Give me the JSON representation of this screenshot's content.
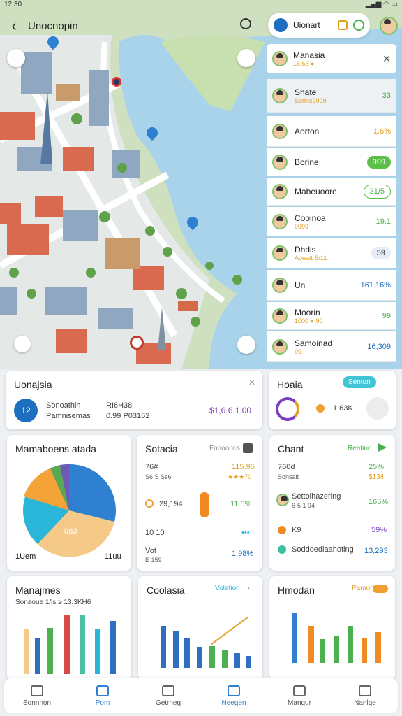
{
  "status": {
    "time": "12:30"
  },
  "header": {
    "title": "Unocnopin"
  },
  "account_pill": {
    "label": "Uionart"
  },
  "notification": {
    "name": "Manasia",
    "sub": "16:63 ●"
  },
  "list": [
    {
      "name": "Snate",
      "sub": "Sonns9999",
      "value": "33",
      "kind": "text",
      "color": "#4caf50"
    },
    {
      "name": "Aorton",
      "value": "1.6%",
      "kind": "text",
      "color": "#e0a020"
    },
    {
      "name": "Borine",
      "value": "999",
      "kind": "pill-green"
    },
    {
      "name": "Mabeuoore",
      "value": "31/5",
      "kind": "pill-outline"
    },
    {
      "name": "Cooinoa",
      "sub": "9999",
      "value": "19.1",
      "kind": "text",
      "color": "#4caf50"
    },
    {
      "name": "Dhdis",
      "sub": "Aoeatt S/11",
      "value": "59",
      "kind": "pill-blue"
    },
    {
      "name": "Un",
      "value": "161.16%",
      "kind": "text",
      "color": "#1e6fc0"
    },
    {
      "name": "Moorin",
      "sub": "1000 ● 90",
      "value": "99",
      "kind": "text",
      "color": "#4caf50"
    },
    {
      "name": "Samoinad",
      "sub": "99",
      "value": "16,309",
      "kind": "text",
      "color": "#1e6fc0"
    }
  ],
  "summary": {
    "title": "Uonajsia",
    "badge": "12",
    "line1": "Sonoathin",
    "line2": "Pamnisemas",
    "line3": "RI6H38",
    "line4": "0.99 P03162",
    "amount": "$1,6 6.1.00"
  },
  "side": {
    "title": "Hoaia",
    "pill": "Senton",
    "mid": "1.63K"
  },
  "pie_card": {
    "title": "Mamaboens atada",
    "label_left": "1Uem",
    "label_right": "11uu",
    "label_mid": "083"
  },
  "stats_card": {
    "title": "Sotacia",
    "link": "Fonooncs",
    "r1l": "76#",
    "r1s": "S6 S Ss6",
    "r1v": "115.95",
    "r1s2": "★★★70",
    "r2l": "29,194",
    "r2v": "11.5%",
    "r3l": "10 10",
    "r4l": "Vot",
    "r4s": "E 159",
    "r4v": "1.98%"
  },
  "chart_card": {
    "title": "Chant",
    "link": "Reatino",
    "r1l": "760d",
    "r1s": "Sonsait",
    "r1v": "25%",
    "r1v2": "$134",
    "r2l": "Settolhazering",
    "r2s": "6-5 1 94",
    "r2v": "165%",
    "r3l": "K9",
    "r3v": "59%",
    "r4l": "Soddoediaahoting",
    "r4v": "13,293"
  },
  "bottom1": {
    "title": "Manajmes",
    "sub": "Sonaoue 1/ls ≥ 13.3KH6"
  },
  "bottom2": {
    "title": "Coolasia",
    "link": "Volation"
  },
  "bottom3": {
    "title": "Hmodan",
    "link": "Pamon"
  },
  "nav": [
    {
      "label": "Sonnnon",
      "icon": "store-icon"
    },
    {
      "label": "Pom",
      "icon": "map-icon",
      "active": true
    },
    {
      "label": "Getrneg",
      "icon": "chat-icon"
    },
    {
      "label": "Neegen",
      "icon": "compass-icon",
      "active": true
    },
    {
      "label": "Mangur",
      "icon": "bag-icon"
    },
    {
      "label": "Nanlge",
      "icon": "search-icon"
    }
  ]
}
